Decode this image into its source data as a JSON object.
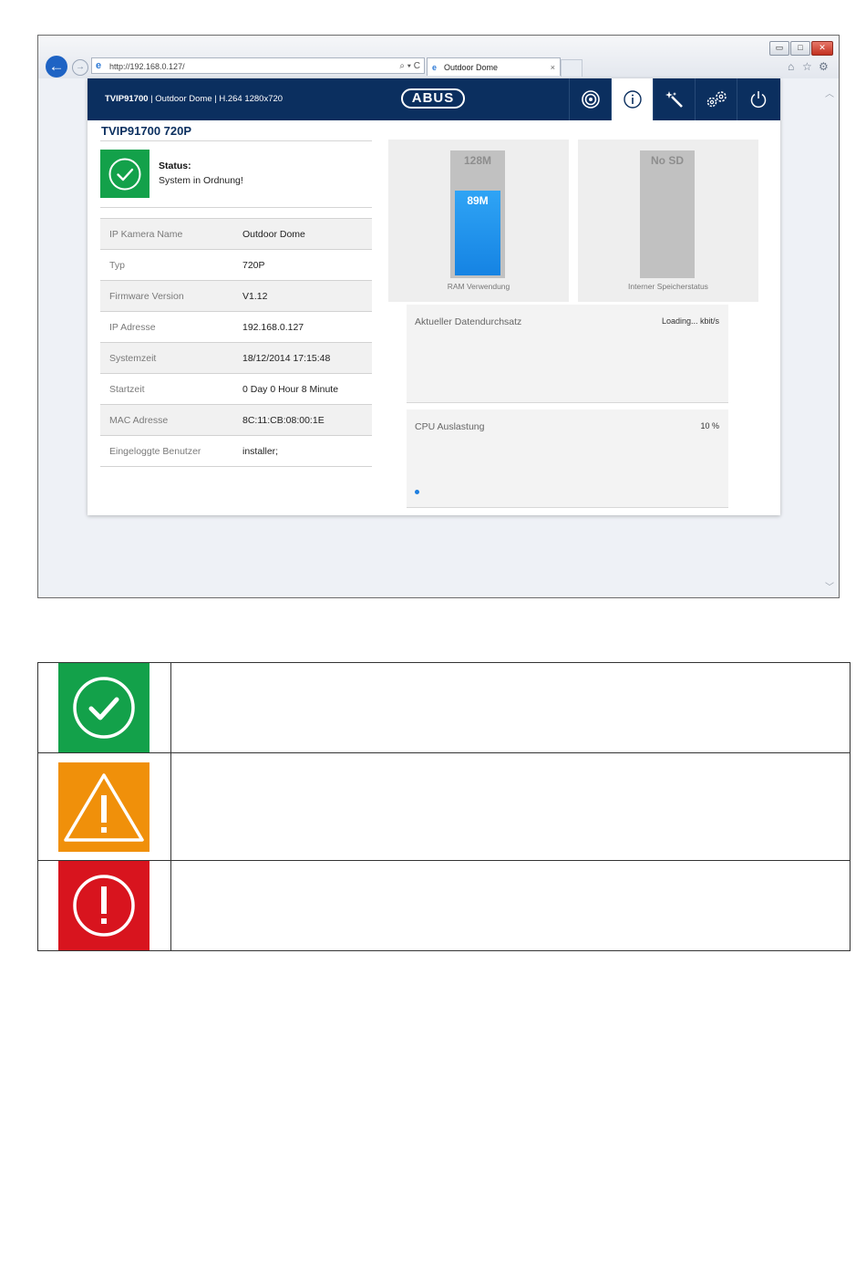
{
  "browser": {
    "address": "http://192.168.0.127/",
    "address_tools": "⌕ ▾ C",
    "tab_title": "Outdoor Dome",
    "tab_close": "×",
    "window_controls": [
      "▭",
      "□",
      "✕"
    ]
  },
  "header": {
    "model": "TVIP91700",
    "subtitle": " | Outdoor Dome | H.264 1280x720",
    "logo": "ABUS",
    "nav": [
      {
        "icon": "camera-lens-icon"
      },
      {
        "icon": "info-icon",
        "active": true
      },
      {
        "icon": "magic-wand-icon"
      },
      {
        "icon": "settings-gears-icon"
      },
      {
        "icon": "power-icon"
      }
    ]
  },
  "device": {
    "title": "TVIP91700 720P",
    "status_label": "Status:",
    "status_text": "System in Ordnung!"
  },
  "info_rows": [
    {
      "label": "IP Kamera Name",
      "value": "Outdoor Dome"
    },
    {
      "label": "Typ",
      "value": "720P"
    },
    {
      "label": "Firmware Version",
      "value": "V1.12"
    },
    {
      "label": "IP Adresse",
      "value": "192.168.0.127"
    },
    {
      "label": "Systemzeit",
      "value": "18/12/2014 17:15:48"
    },
    {
      "label": "Startzeit",
      "value": "0 Day 0 Hour 8 Minute"
    },
    {
      "label": "MAC Adresse",
      "value": "8C:11:CB:08:00:1E"
    },
    {
      "label": "Eingeloggte Benutzer",
      "value": "installer;"
    }
  ],
  "ram": {
    "capacity": "128M",
    "used": "89M",
    "used_fraction": 0.695,
    "caption": "RAM Verwendung"
  },
  "storage": {
    "capacity": "No SD",
    "caption": "Interner Speicherstatus"
  },
  "throughput": {
    "label": "Aktueller Datendurchsatz",
    "value": "Loading... kbit/s"
  },
  "cpu": {
    "label": "CPU Auslastung",
    "value": "10 %"
  },
  "colors": {
    "header": "#0b2f5f",
    "ok": "#13a14a",
    "warning": "#f0900a",
    "error": "#d8141e",
    "ram_bar": "#1e8fef"
  },
  "legend": [
    {
      "icon": "check-circle-icon",
      "color": "#13a14a",
      "text": ""
    },
    {
      "icon": "warning-triangle-icon",
      "color": "#f0900a",
      "text": ""
    },
    {
      "icon": "error-circle-icon",
      "color": "#d8141e",
      "text": ""
    }
  ]
}
